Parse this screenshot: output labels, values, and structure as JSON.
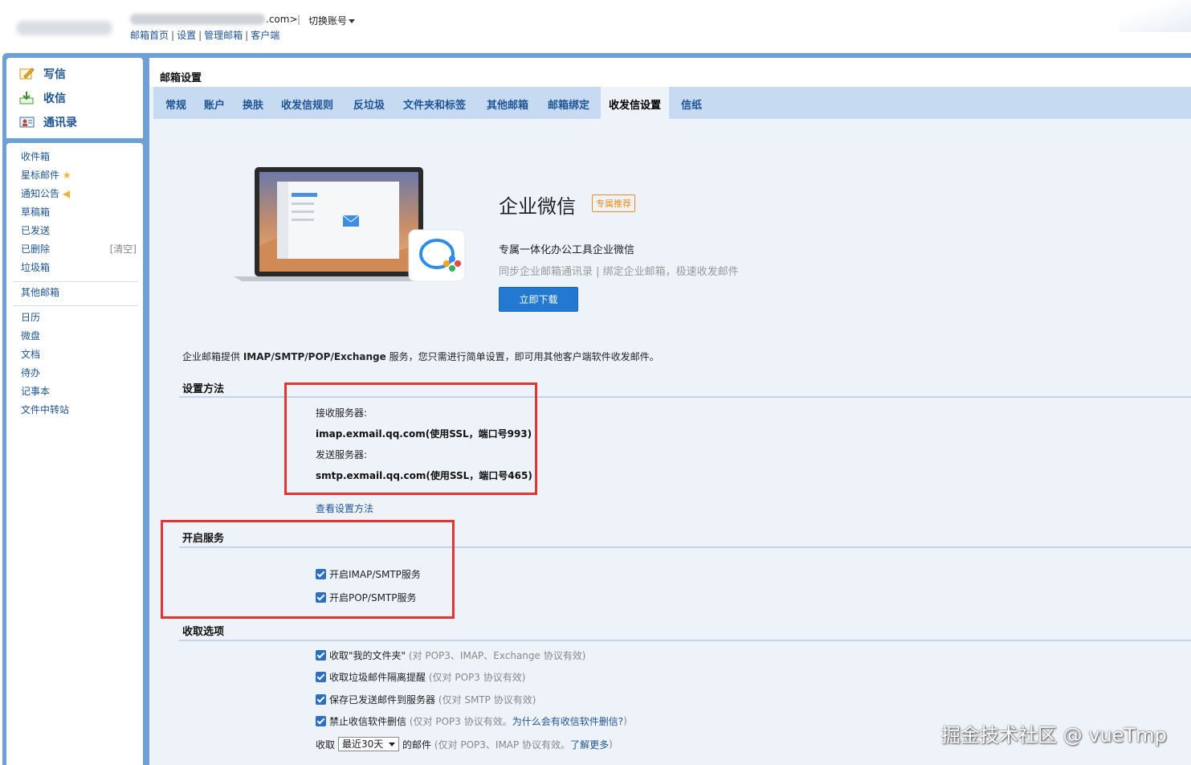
{
  "header": {
    "account_suffix": ".com>",
    "switch_account": "切换账号",
    "links": [
      "邮箱首页",
      "设置",
      "管理邮箱",
      "客户端"
    ]
  },
  "quick_actions": [
    {
      "label": "写信",
      "icon": "compose-icon"
    },
    {
      "label": "收信",
      "icon": "inbox-download-icon"
    },
    {
      "label": "通讯录",
      "icon": "contacts-icon"
    }
  ],
  "folders": {
    "group1": [
      "收件箱",
      "星标邮件",
      "通知公告",
      "草稿箱",
      "已发送",
      "已删除",
      "垃圾箱"
    ],
    "clear_label": "[清空]",
    "group2": [
      "其他邮箱"
    ],
    "group3": [
      "日历",
      "微盘",
      "文档",
      "待办",
      "记事本",
      "文件中转站"
    ]
  },
  "main": {
    "title": "邮箱设置",
    "tabs": [
      "常规",
      "账户",
      "换肤",
      "收发信规则",
      "反垃圾",
      "文件夹和标签",
      "其他邮箱",
      "邮箱绑定",
      "收发信设置",
      "信纸"
    ],
    "active_tab": "收发信设置"
  },
  "promo": {
    "title": "企业微信",
    "badge": "专属推荐",
    "subtitle": "专属一体化办公工具企业微信",
    "desc": "同步企业邮箱通讯录 | 绑定企业邮箱，极速收发邮件",
    "button": "立即下载"
  },
  "intro": {
    "prefix": "企业邮箱提供 ",
    "protocols": "IMAP/SMTP/POP/Exchange",
    "suffix": " 服务，您只需进行简单设置，即可用其他客户端软件收发邮件。"
  },
  "setup": {
    "title": "设置方法",
    "recv_label": "接收服务器:",
    "recv_value": "imap.exmail.qq.com(使用SSL，端口号993)",
    "send_label": "发送服务器:",
    "send_value": "smtp.exmail.qq.com(使用SSL，端口号465)",
    "help_link": "查看设置方法"
  },
  "services": {
    "title": "开启服务",
    "imap": "开启IMAP/SMTP服务",
    "pop": "开启POP/SMTP服务"
  },
  "receive": {
    "title": "收取选项",
    "opt1": "收取\"我的文件夹\"",
    "opt1_note": "(对 POP3、IMAP、Exchange 协议有效)",
    "opt2": "收取垃圾邮件隔离提醒",
    "opt2_note": "(仅对 POP3 协议有效)",
    "opt3": "保存已发送邮件到服务器",
    "opt3_note": "(仅对 SMTP 协议有效)",
    "opt4": "禁止收信软件删信",
    "opt4_note_a": "(仅对 POP3 协议有效。",
    "opt4_link": "为什么会有收信软件删信?",
    "opt4_note_b": ")",
    "period_prefix": "收取",
    "period_value": "最近30天",
    "period_suffix": "的邮件",
    "period_note": "(仅对 POP3、IMAP 协议有效。",
    "period_link": "了解更多",
    "period_note_end": ")"
  },
  "watermark": "掘金技术社区 @ vueTmp",
  "colors": {
    "accent": "#2378d1",
    "link": "#1e5494",
    "highlight_box": "#e6332e",
    "badge": "#f08a1c",
    "tab_bar": "#c6daf1"
  }
}
